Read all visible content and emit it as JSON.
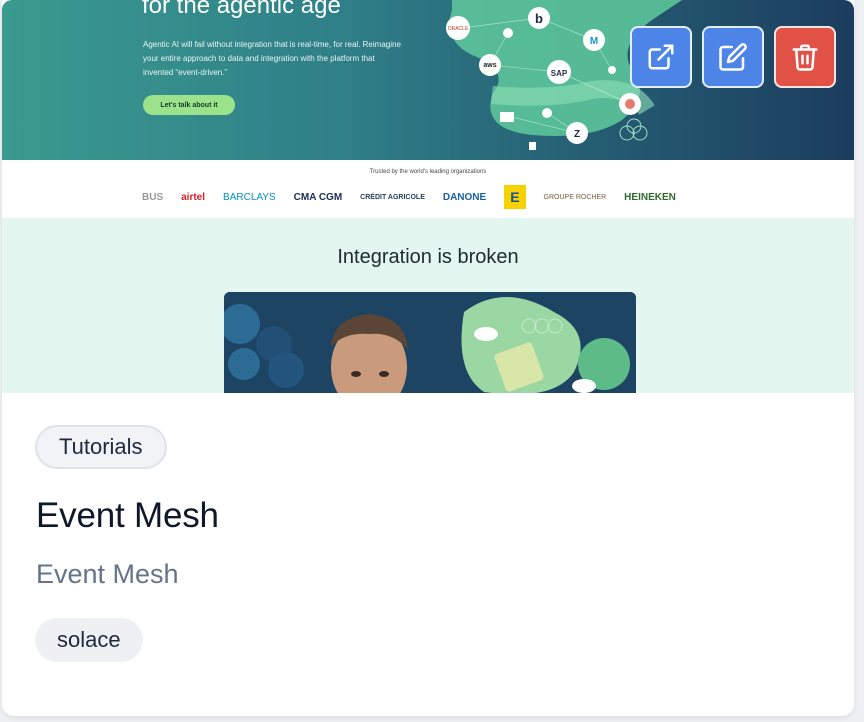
{
  "preview": {
    "hero_title": "for the agentic age",
    "hero_text": "Agentic AI will fail without integration that is real-time, for real. Reimagine your entire approach to data and integration with the platform that invented “event-driven.”",
    "hero_cta": "Let's talk about it",
    "trusted_label": "Trusted by the world's leading organizations",
    "logos": [
      "BUS",
      "airtel",
      "BARCLAYS",
      "CMA CGM",
      "CRÉDIT AGRICOLE",
      "DANONE",
      "E",
      "GROUPE ROCHER",
      "HEINEKEN"
    ],
    "section_title": "Integration is broken",
    "network_labels": [
      "b",
      "aws",
      "SAP",
      "M",
      "Z"
    ]
  },
  "actions": {
    "open_icon": "external-link-icon",
    "edit_icon": "edit-icon",
    "delete_icon": "trash-icon"
  },
  "card": {
    "category": "Tutorials",
    "title": "Event Mesh",
    "subtitle": "Event Mesh",
    "tag": "solace"
  },
  "colors": {
    "action_blue": "#4d84e8",
    "action_red": "#e15146",
    "hero_start": "#3a9a8f",
    "hero_end": "#1c3d5e",
    "section_bg": "#e3f6ef"
  }
}
